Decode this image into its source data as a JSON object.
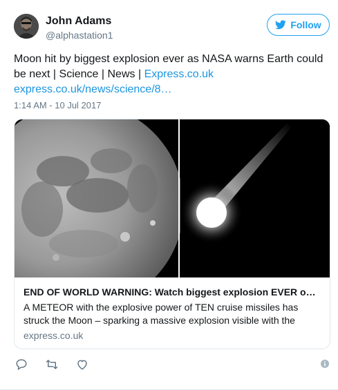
{
  "author": {
    "name": "John Adams",
    "handle": "@alphastation1"
  },
  "follow_button": {
    "label": "Follow",
    "icon": "twitter-bird-icon"
  },
  "tweet": {
    "text": "Moon hit by biggest explosion ever as NASA warns Earth could be next | Science | News | ",
    "inline_link": "Express.co.uk",
    "url": "express.co.uk/news/science/8…",
    "timestamp": "1:14 AM - 10 Jul 2017"
  },
  "card": {
    "title": "END OF WORLD WARNING: Watch biggest explosion EVER o…",
    "description": "A METEOR with the explosive power of TEN cruise missiles has struck the Moon – sparking a massive explosion visible with the",
    "domain": "express.co.uk"
  },
  "actions": [
    "reply-icon",
    "retweet-icon",
    "like-icon"
  ],
  "colors": {
    "accent": "#1da1f2",
    "link": "#1b95e0",
    "muted": "#657786",
    "text": "#14171a"
  }
}
